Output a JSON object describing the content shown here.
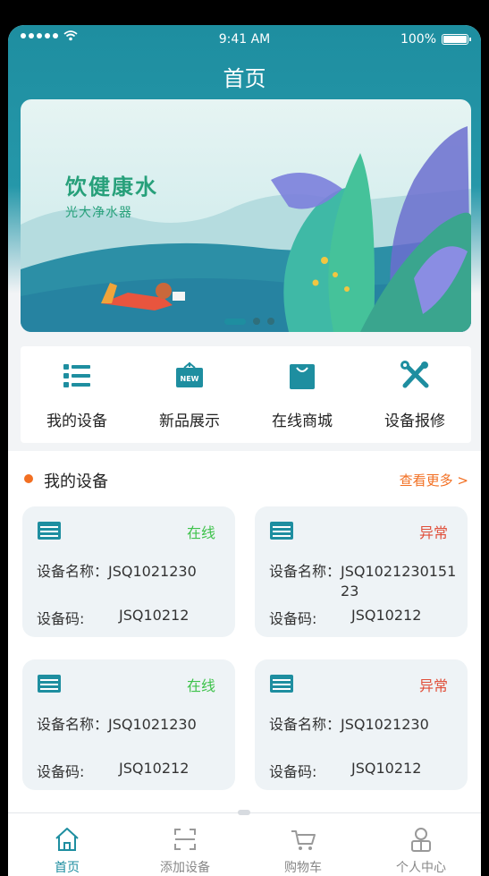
{
  "status_bar": {
    "time": "9:41 AM",
    "battery": "100%"
  },
  "header": {
    "title": "首页"
  },
  "banner": {
    "title": "饮健康水",
    "subtitle": "光大净水器",
    "page_count": 3,
    "active_page": 1
  },
  "quick_actions": [
    {
      "label": "我的设备",
      "icon": "list-icon"
    },
    {
      "label": "新品展示",
      "icon": "new-icon"
    },
    {
      "label": "在线商城",
      "icon": "shopping-bag-icon"
    },
    {
      "label": "设备报修",
      "icon": "tools-icon"
    }
  ],
  "section": {
    "title": "我的设备",
    "more": "查看更多 >"
  },
  "devices": [
    {
      "status": "在线",
      "name_key": "设备名称：",
      "name": "JSQ1021230",
      "code_key": "设备码:",
      "code": "JSQ10212"
    },
    {
      "status": "异常",
      "name_key": "设备名称：",
      "name": "JSQ102123015123",
      "code_key": "设备码:",
      "code": "JSQ10212"
    },
    {
      "status": "在线",
      "name_key": "设备名称：",
      "name": "JSQ1021230",
      "code_key": "设备码:",
      "code": "JSQ10212"
    },
    {
      "status": "异常",
      "name_key": "设备名称：",
      "name": "JSQ1021230",
      "code_key": "设备码:",
      "code": "JSQ10212"
    }
  ],
  "tabs": [
    {
      "label": "首页",
      "icon": "home-icon",
      "active": true
    },
    {
      "label": "添加设备",
      "icon": "scan-icon",
      "active": false
    },
    {
      "label": "购物车",
      "icon": "cart-icon",
      "active": false
    },
    {
      "label": "个人中心",
      "icon": "user-icon",
      "active": false
    }
  ],
  "colors": {
    "primary": "#1e8ea0",
    "accent": "#f26f22",
    "online": "#3ec24b",
    "error": "#e04f3a"
  }
}
